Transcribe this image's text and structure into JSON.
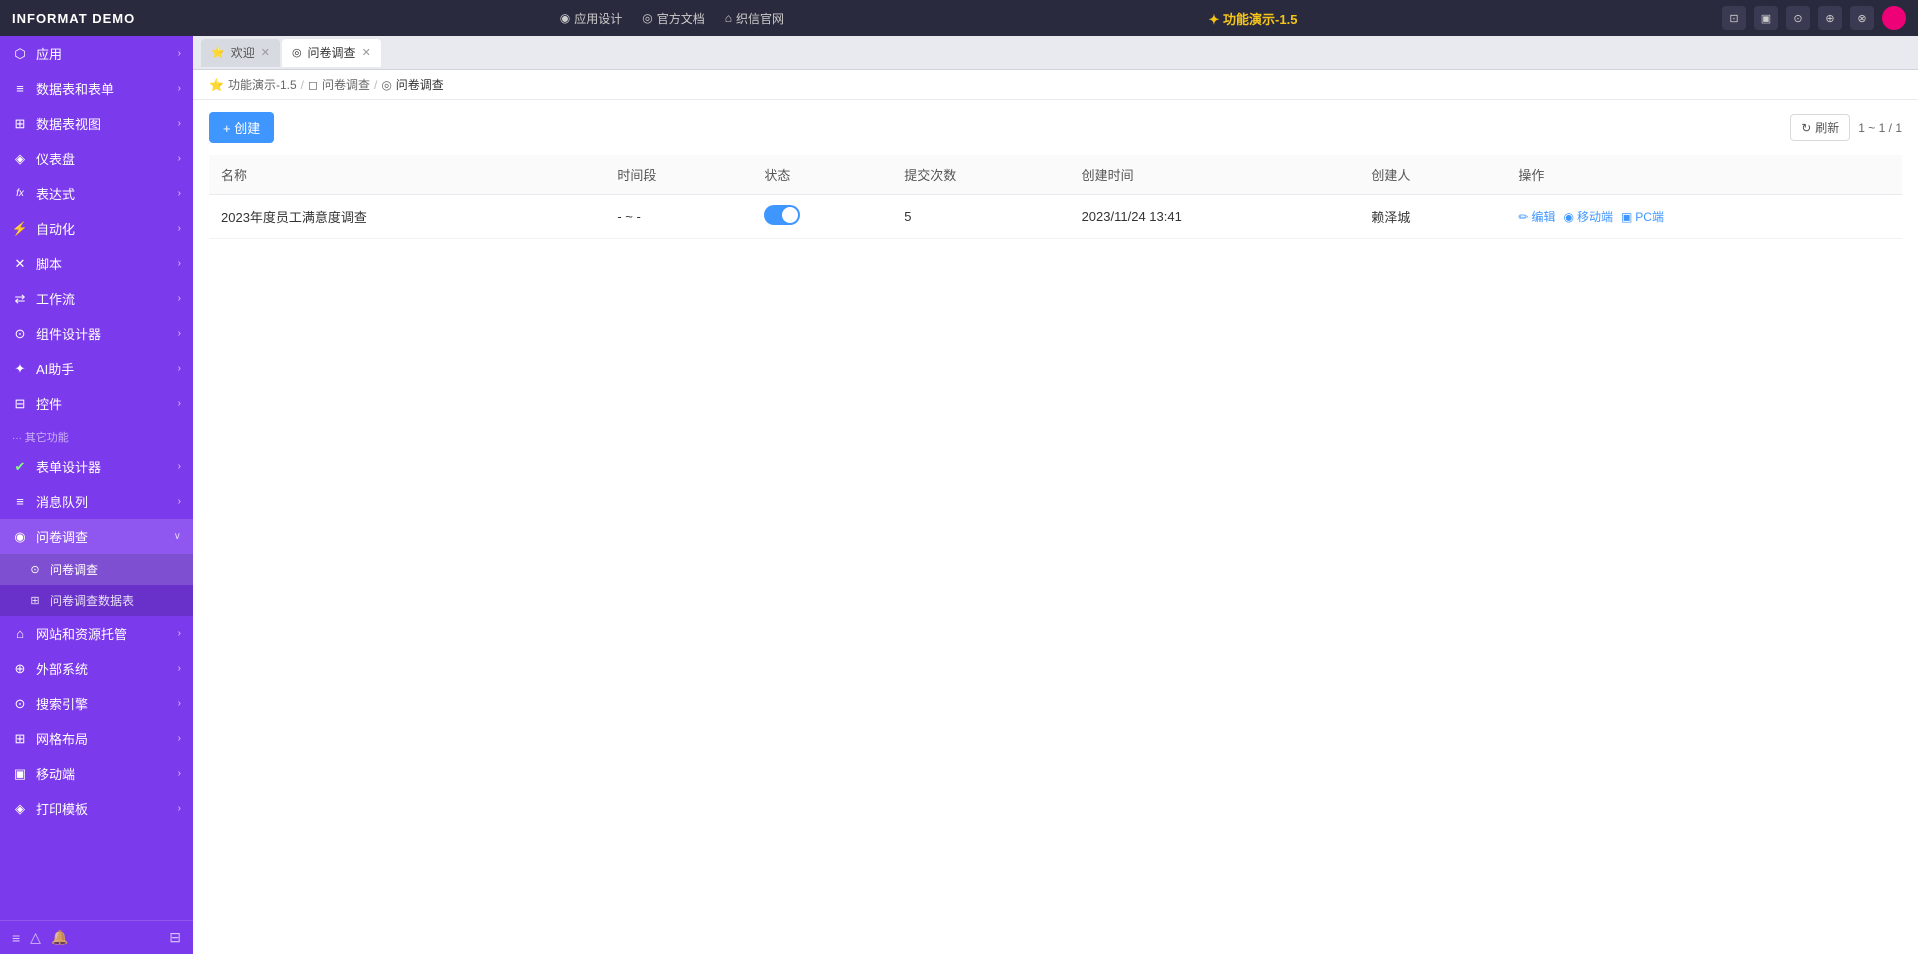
{
  "topbar": {
    "logo": "INFORMAT DEMO",
    "nav": [
      {
        "label": "应用设计",
        "icon": "◉"
      },
      {
        "label": "官方文档",
        "icon": "◎"
      },
      {
        "label": "织信官网",
        "icon": "⌂"
      }
    ],
    "center_label": "✦ 功能演示-1.5",
    "icons": [
      "⊡",
      "▣",
      "⊙",
      "⊕",
      "⊗"
    ]
  },
  "sidebar": {
    "items": [
      {
        "label": "应用",
        "icon": "⬡",
        "hasChildren": true
      },
      {
        "label": "数据表和表单",
        "icon": "≡",
        "hasChildren": true
      },
      {
        "label": "数据表视图",
        "icon": "⊞",
        "hasChildren": true
      },
      {
        "label": "仪表盘",
        "icon": "◈",
        "hasChildren": true
      },
      {
        "label": "表达式",
        "icon": "fx",
        "hasChildren": true
      },
      {
        "label": "自动化",
        "icon": "⚡",
        "hasChildren": true
      },
      {
        "label": "脚本",
        "icon": "✕",
        "hasChildren": true
      },
      {
        "label": "工作流",
        "icon": "⇄",
        "hasChildren": true
      },
      {
        "label": "组件设计器",
        "icon": "⊙",
        "hasChildren": true
      },
      {
        "label": "AI助手",
        "icon": "✦",
        "hasChildren": true
      },
      {
        "label": "控件",
        "icon": "⊟",
        "hasChildren": true
      }
    ],
    "section_other": "其它功能",
    "other_items": [
      {
        "label": "表单设计器",
        "icon": "✔",
        "hasChildren": true
      },
      {
        "label": "消息队列",
        "icon": "≡",
        "hasChildren": true
      },
      {
        "label": "问卷调查",
        "icon": "◉",
        "hasChildren": false,
        "expanded": true
      },
      {
        "label": "网站和资源托管",
        "icon": "⌂",
        "hasChildren": true
      },
      {
        "label": "外部系统",
        "icon": "⊕",
        "hasChildren": true
      },
      {
        "label": "搜索引擎",
        "icon": "⊙",
        "hasChildren": true
      },
      {
        "label": "网格布局",
        "icon": "⊞",
        "hasChildren": true
      },
      {
        "label": "移动端",
        "icon": "▣",
        "hasChildren": true
      },
      {
        "label": "打印模板",
        "icon": "◈",
        "hasChildren": true
      }
    ],
    "sub_items": [
      {
        "label": "问卷调查",
        "icon": "⊙",
        "active": true
      },
      {
        "label": "问卷调查数据表",
        "icon": "⊞",
        "active": false
      }
    ],
    "bottom_icons": [
      "≡",
      "△",
      "🔔",
      "⊟"
    ]
  },
  "tabs": [
    {
      "label": "欢迎",
      "icon": "⭐",
      "active": false,
      "closeable": true
    },
    {
      "label": "问卷调查",
      "icon": "◎",
      "active": true,
      "closeable": true
    }
  ],
  "breadcrumb": [
    {
      "label": "功能演示-1.5",
      "icon": "⭐"
    },
    {
      "label": "问卷调查",
      "icon": "◻"
    },
    {
      "label": "问卷调查",
      "icon": "◎"
    }
  ],
  "toolbar": {
    "create_label": "+ 创建",
    "refresh_label": "刷新",
    "pagination": "1 ~ 1 / 1"
  },
  "table": {
    "columns": [
      "名称",
      "时间段",
      "状态",
      "提交次数",
      "创建时间",
      "创建人",
      "操作"
    ],
    "rows": [
      {
        "name": "2023年度员工满意度调查",
        "time_range": "- ~ -",
        "status_on": true,
        "submit_count": "5",
        "created_at": "2023/11/24 13:41",
        "created_by": "赖泽城",
        "actions": [
          "编辑",
          "移动端",
          "PC端"
        ]
      }
    ]
  }
}
